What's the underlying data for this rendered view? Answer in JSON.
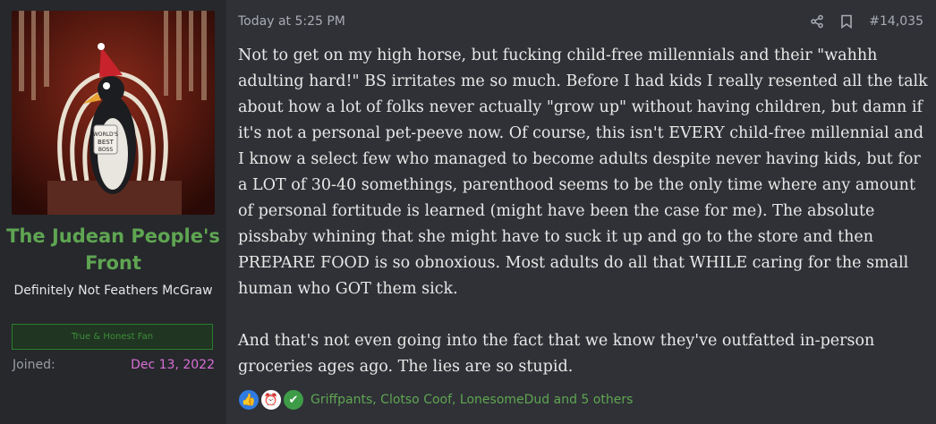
{
  "post": {
    "user": {
      "name": "The Judean People's Front",
      "title": "Definitely Not Feathers McGraw",
      "banner": "True & Honest Fan",
      "joined_label": "Joined:",
      "joined_value": "Dec 13, 2022",
      "avatar_icon": "penguin-avatar-icon"
    },
    "header": {
      "timestamp": "Today at 5:25 PM",
      "post_number": "#14,035",
      "share_icon": "share-icon",
      "bookmark_icon": "bookmark-icon"
    },
    "body": {
      "paragraphs": [
        "Not to get on my high horse, but fucking child-free millennials and their \"wahhh adulting hard!\" BS irritates me so much. Before I had kids I really resented all the talk about how a lot of folks never actually \"grow up\" without having children, but damn if it's not a personal pet-peeve now. Of course, this isn't EVERY child-free millennial and I know a select few who managed to become adults despite never having kids, but for a LOT of 30-40 somethings, parenthood seems to be the only time where any amount of personal fortitude is learned (might have been the case for me). The absolute pissbaby whining that she might have to suck it up and go to the store and then PREPARE FOOD is so obnoxious. Most adults do all that WHILE caring for the small human who GOT them sick.",
        "And that's not even going into the fact that we know they've outfatted in-person groceries ages ago. The lies are so stupid."
      ]
    },
    "reactions": {
      "icons": [
        "like-icon",
        "alarm-clock-icon",
        "checkmark-icon"
      ],
      "text": "Griffpants, Clotso Coof, LonesomeDud and 5 others"
    },
    "colors": {
      "username": "#5fa552",
      "joined_date": "#d86fd5",
      "banner_border": "#2b7d2f"
    }
  }
}
